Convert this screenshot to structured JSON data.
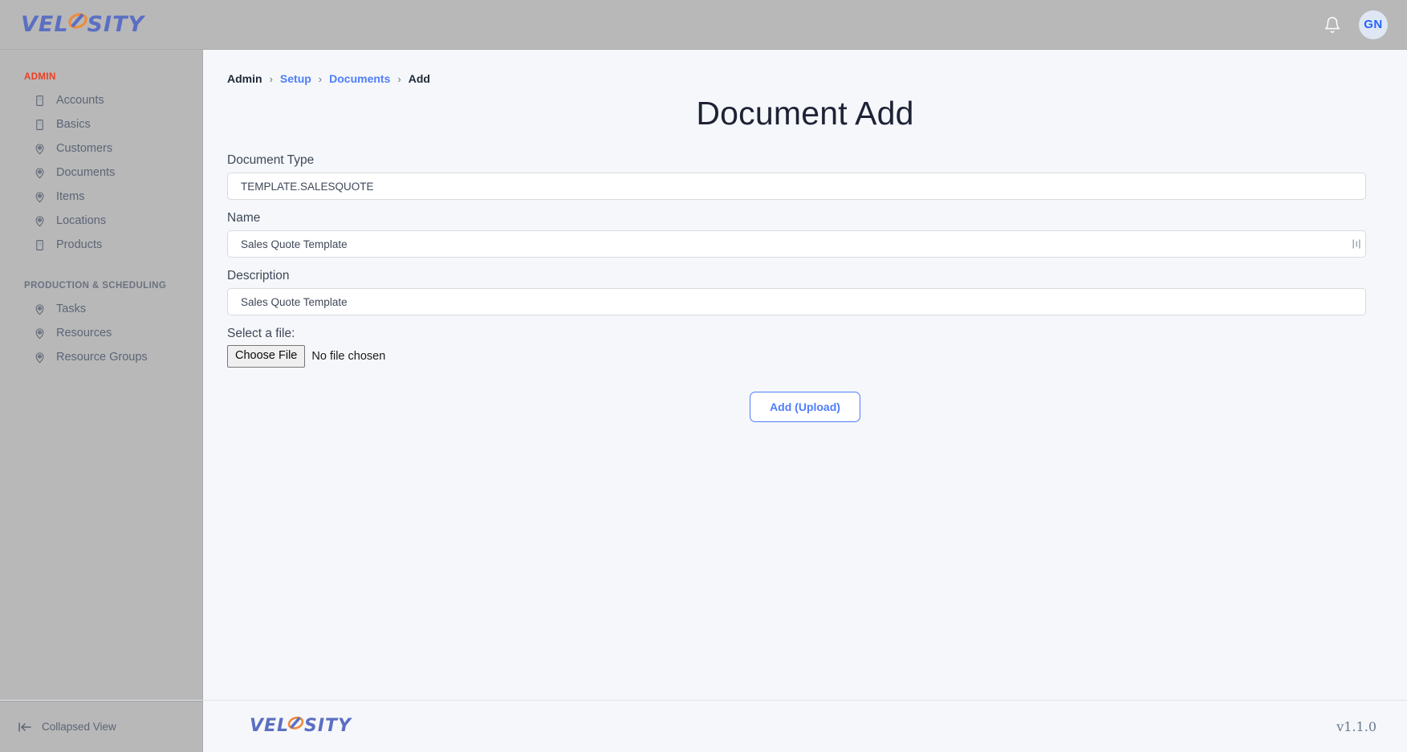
{
  "header": {
    "logo_text_part1": "VEL",
    "logo_text_part2": "SITY",
    "bell_icon": "bell-icon",
    "avatar_initials": "GN",
    "avatar_bg": "#dfe7f5",
    "avatar_color": "#2563ff",
    "bar_bg": "#b8b8b8"
  },
  "sidebar": {
    "sections": [
      {
        "label": "ADMIN",
        "color": "#f03b20",
        "items": [
          {
            "label": "Accounts",
            "icon": "building-icon"
          },
          {
            "label": "Basics",
            "icon": "building-icon"
          },
          {
            "label": "Customers",
            "icon": "map-pin-icon"
          },
          {
            "label": "Documents",
            "icon": "map-pin-icon"
          },
          {
            "label": "Items",
            "icon": "map-pin-icon"
          },
          {
            "label": "Locations",
            "icon": "map-pin-icon"
          },
          {
            "label": "Products",
            "icon": "building-icon"
          }
        ]
      },
      {
        "label": "PRODUCTION & SCHEDULING",
        "color": "#6b7280",
        "items": [
          {
            "label": "Tasks",
            "icon": "map-pin-icon"
          },
          {
            "label": "Resources",
            "icon": "map-pin-icon"
          },
          {
            "label": "Resource Groups",
            "icon": "map-pin-icon"
          }
        ]
      }
    ]
  },
  "breadcrumb": {
    "items": [
      {
        "label": "Admin",
        "link": false
      },
      {
        "label": "Setup",
        "link": true
      },
      {
        "label": "Documents",
        "link": true
      },
      {
        "label": "Add",
        "link": false
      }
    ],
    "separator": "›",
    "link_color": "#4f7dfb"
  },
  "main": {
    "title": "Document Add",
    "fields": [
      {
        "label": "Document Type",
        "value": "TEMPLATE.SALESQUOTE",
        "placeholder": "Document Type",
        "has_grip": false
      },
      {
        "label": "Name",
        "value": "Sales Quote Template",
        "placeholder": "Name",
        "has_grip": true
      },
      {
        "label": "Description",
        "value": "Sales Quote Template",
        "placeholder": "Description",
        "has_grip": false
      }
    ],
    "file_picker": {
      "label": "Select a file:",
      "button_label": "Choose File",
      "status": "No file chosen"
    },
    "submit_label": "Add (Upload)",
    "submit_color": "#4f7dfb"
  },
  "footer": {
    "collapse_label": "Collapsed View",
    "collapse_icon": "collapse-left-icon",
    "logo_text_part1": "VEL",
    "logo_text_part2": "SITY",
    "version": "v1.1.0"
  }
}
